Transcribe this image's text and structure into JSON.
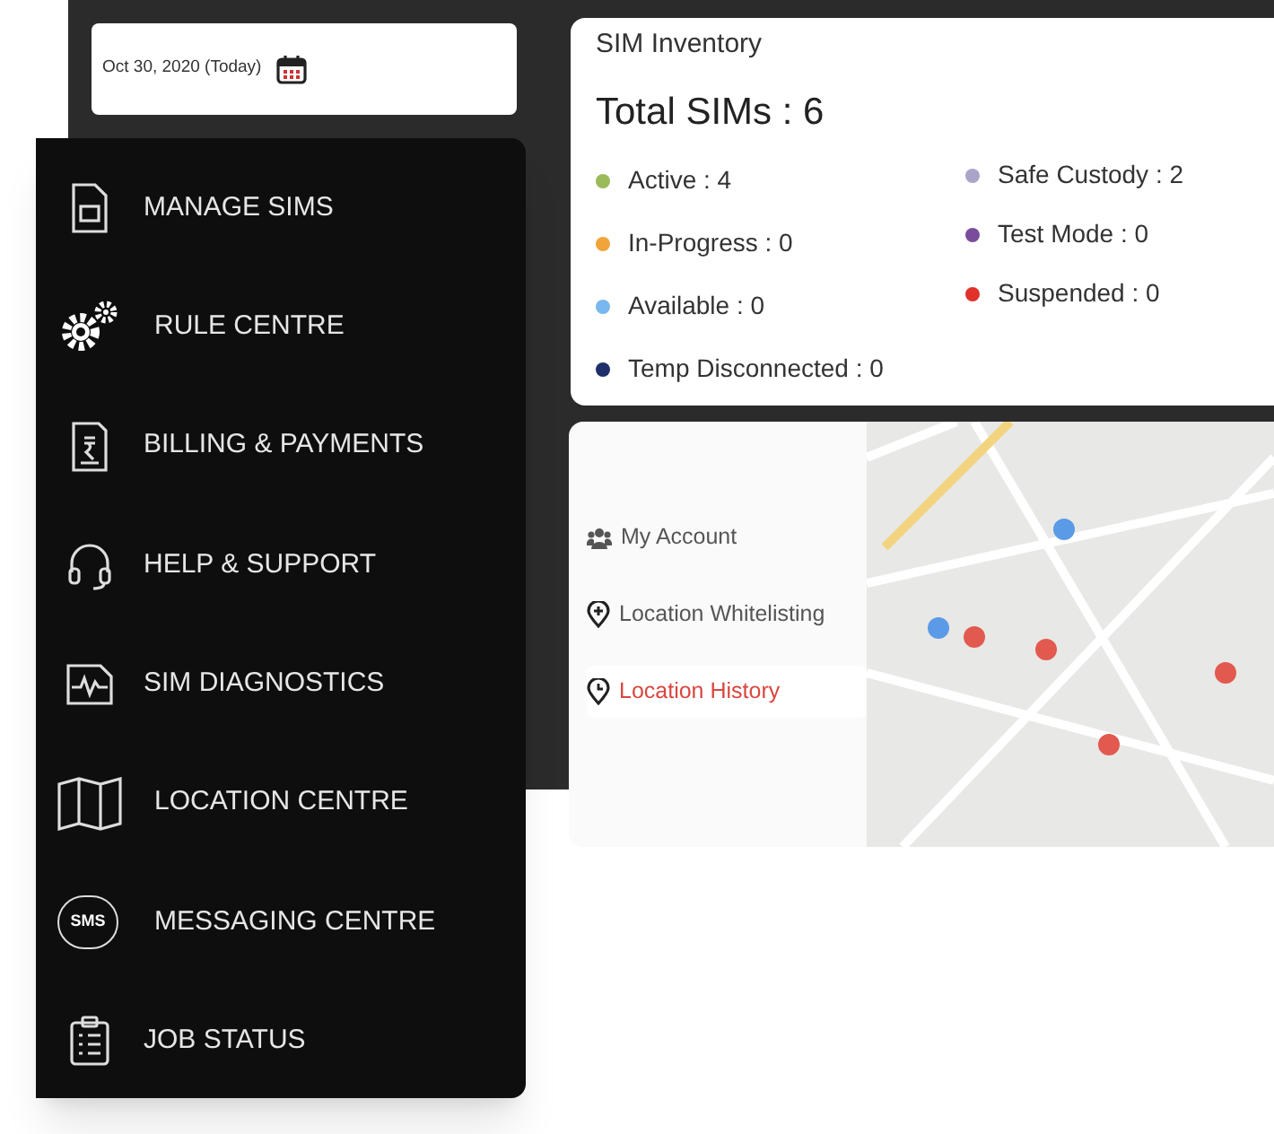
{
  "date_picker": {
    "value": "Oct 30, 2020 (Today)"
  },
  "menu": {
    "items": [
      {
        "label": "MANAGE SIMS"
      },
      {
        "label": "RULE CENTRE"
      },
      {
        "label": "BILLING & PAYMENTS"
      },
      {
        "label": "HELP & SUPPORT"
      },
      {
        "label": "SIM DIAGNOSTICS"
      },
      {
        "label": "LOCATION CENTRE"
      },
      {
        "label": "MESSAGING CENTRE",
        "icon_text": "SMS"
      },
      {
        "label": "JOB STATUS"
      }
    ]
  },
  "sim_inventory": {
    "title": "SIM Inventory",
    "total": "Total SIMs : 6",
    "columns": [
      [
        {
          "label": "Active : 4",
          "color": "#9bbb59"
        },
        {
          "label": "In-Progress : 0",
          "color": "#f0a43a"
        },
        {
          "label": "Available : 0",
          "color": "#78b8ee"
        },
        {
          "label": "Temp Disconnected : 0",
          "color": "#1f2f6b"
        }
      ],
      [
        {
          "label": "Safe Custody : 2",
          "color": "#a9a4c8"
        },
        {
          "label": "Test Mode : 0",
          "color": "#7a4d9c"
        },
        {
          "label": "Suspended : 0",
          "color": "#e0312b"
        }
      ]
    ]
  },
  "location": {
    "items": [
      {
        "label": "My Account",
        "selected": false
      },
      {
        "label": "Location Whitelisting",
        "selected": false
      },
      {
        "label": "Location History",
        "selected": true
      }
    ]
  }
}
